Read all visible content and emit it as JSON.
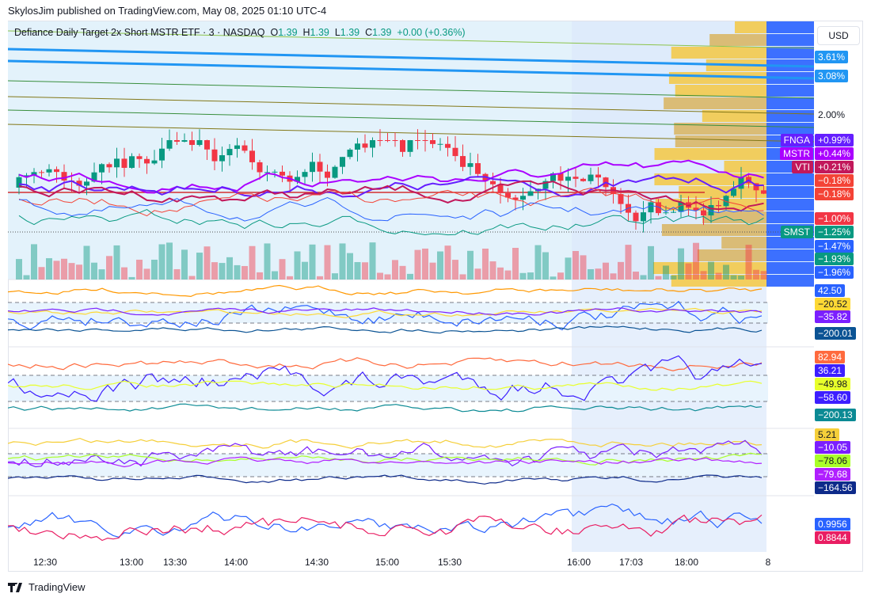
{
  "header": {
    "published": "SkylosJim published on TradingView.com, May 08, 2025 01:10 UTC-4"
  },
  "legend": {
    "symbol": "Defiance Daily Target 2x Short MSTR ETF · 3 · NASDAQ",
    "o_label": "O",
    "o": "1.39",
    "h_label": "H",
    "h": "1.39",
    "l_label": "L",
    "l": "1.39",
    "c_label": "C",
    "c": "1.39",
    "change": "+0.00 (+0.36%)"
  },
  "currency": "USD",
  "price_labels": [
    {
      "text": "3.61%",
      "color": "#2196f3"
    },
    {
      "text": "3.08%",
      "color": "#2196f3"
    },
    {
      "text": "2.00%",
      "color": "transparent"
    },
    {
      "text": "+0.99%",
      "color": "#651fff",
      "tag": "FNGA"
    },
    {
      "text": "+0.44%",
      "color": "#aa00ff",
      "tag": "MSTR"
    },
    {
      "text": "+0.21%",
      "color": "#c2185b",
      "tag": "VTI"
    },
    {
      "text": "−0.18%",
      "color": "#f44336"
    },
    {
      "text": "−0.18%",
      "color": "#f44336"
    },
    {
      "text": "−1.00%",
      "color": "#f23645"
    },
    {
      "text": "−1.25%",
      "color": "#089981",
      "tag": "SMST"
    },
    {
      "text": "−1.47%",
      "color": "#2962ff"
    },
    {
      "text": "−1.93%",
      "color": "#089981"
    },
    {
      "text": "−1.96%",
      "color": "#2962ff"
    }
  ],
  "pane_labels": [
    [
      {
        "text": "42.50",
        "color": "#2962ff"
      },
      {
        "text": "−20.52",
        "color": "#fdd835",
        "dark": true
      },
      {
        "text": "−35.82",
        "color": "#7b1fff"
      },
      {
        "text": "−200.01",
        "color": "#0b5394"
      }
    ],
    [
      {
        "text": "82.94",
        "color": "#ff6a3d"
      },
      {
        "text": "36.21",
        "color": "#3d1fff"
      },
      {
        "text": "−49.98",
        "color": "#e8ff2a",
        "dark": true
      },
      {
        "text": "−58.60",
        "color": "#3d1fff"
      },
      {
        "text": "−200.13",
        "color": "#0b8a94"
      }
    ],
    [
      {
        "text": "5.21",
        "color": "#f5cf3a",
        "dark": true
      },
      {
        "text": "−10.05",
        "color": "#7b1fff"
      },
      {
        "text": "−78.06",
        "color": "#aaff2a",
        "dark": true
      },
      {
        "text": "−79.68",
        "color": "#b01fff"
      },
      {
        "text": "−164.56",
        "color": "#0d2a8a"
      }
    ],
    [
      {
        "text": "0.9956",
        "color": "#2962ff"
      },
      {
        "text": "0.8844",
        "color": "#e91e63"
      }
    ]
  ],
  "time_axis": [
    "12:30",
    "13:00",
    "13:30",
    "14:00",
    "14:30",
    "15:00",
    "15:30",
    "16:00",
    "17:03",
    "18:00",
    "8"
  ],
  "footer": {
    "brand": "TradingView"
  },
  "chart_data": {
    "type": "candlestick",
    "symbol": "SMST",
    "interval": "3",
    "exchange": "NASDAQ",
    "last_close": 1.39,
    "change_pct": 0.36,
    "y_scale": "percent",
    "comparisons": [
      "FNGA",
      "MSTR",
      "VTI"
    ],
    "panes": 5
  }
}
